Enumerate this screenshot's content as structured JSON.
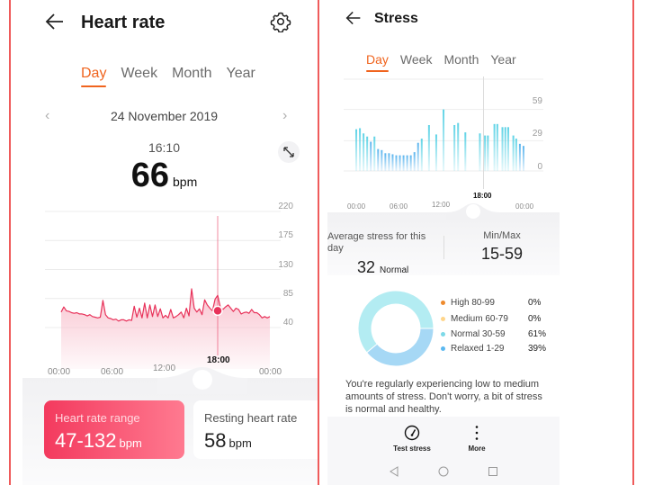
{
  "heart_rate": {
    "title": "Heart rate",
    "tabs": [
      {
        "label": "Day",
        "active": true
      },
      {
        "label": "Week",
        "active": false
      },
      {
        "label": "Month",
        "active": false
      },
      {
        "label": "Year",
        "active": false
      }
    ],
    "date": "24 November 2019",
    "selected_time": "16:10",
    "selected_value": "66",
    "unit": "bpm",
    "icons": [
      "back-arrow-icon",
      "settings-gear-icon",
      "chevron-left-icon",
      "chevron-right-icon",
      "expand-icon"
    ],
    "accent_color": "#f33a5e",
    "cards": {
      "range_label": "Heart rate range",
      "range_value": "47-132",
      "resting_label": "Resting heart rate",
      "resting_value": "58",
      "unit": "bpm"
    },
    "chart_data": {
      "type": "area",
      "title": "",
      "xlabel": "",
      "ylabel": "bpm",
      "ylim": [
        40,
        220
      ],
      "y_ticks": [
        "220",
        "175",
        "130",
        "85",
        "40"
      ],
      "x_ticks": [
        "00:00",
        "06:00",
        "12:00",
        "00:00"
      ],
      "selected_x_label": "18:00",
      "x_hours": [
        0,
        0.3,
        0.6,
        0.9,
        1.2,
        1.5,
        1.8,
        2.1,
        2.4,
        2.7,
        3.0,
        3.3,
        3.6,
        3.9,
        4.2,
        4.5,
        4.8,
        5.1,
        5.4,
        5.7,
        6.0,
        6.3,
        6.6,
        6.9,
        7.2,
        7.5,
        7.8,
        8.1,
        8.4,
        8.7,
        9.0,
        9.3,
        9.6,
        9.9,
        10.2,
        10.5,
        10.8,
        11.1,
        11.4,
        11.7,
        12.0,
        12.3,
        12.6,
        12.9,
        13.2,
        13.5,
        13.8,
        14.1,
        14.4,
        14.7,
        15.0,
        15.3,
        15.6,
        15.9,
        16.2,
        16.5,
        16.8,
        17.1,
        17.4,
        17.7,
        18.0,
        18.3,
        18.6,
        18.9,
        19.2,
        19.5,
        19.8,
        20.1,
        20.4,
        20.7,
        21.0,
        21.3,
        21.6,
        21.9,
        22.2,
        22.5,
        22.8,
        23.1,
        23.4,
        23.7,
        24.0
      ],
      "values": [
        64,
        72,
        66,
        65,
        63,
        62,
        63,
        61,
        61,
        60,
        58,
        60,
        57,
        56,
        55,
        56,
        82,
        60,
        55,
        54,
        52,
        53,
        50,
        52,
        52,
        50,
        52,
        51,
        73,
        56,
        70,
        55,
        78,
        55,
        75,
        57,
        75,
        57,
        69,
        55,
        59,
        55,
        68,
        55,
        57,
        60,
        64,
        55,
        70,
        58,
        100,
        70,
        64,
        69,
        60,
        83,
        75,
        70,
        66,
        84,
        90,
        72,
        68,
        72,
        75,
        70,
        65,
        70,
        68,
        61,
        63,
        64,
        62,
        68,
        63,
        63,
        60,
        55,
        57,
        55,
        57
      ],
      "selected_point_value": 66,
      "fill_color": "#f9c3cf",
      "line_color": "#e8325a"
    }
  },
  "stress": {
    "title": "Stress",
    "tabs": [
      {
        "label": "Day",
        "active": true
      },
      {
        "label": "Week",
        "active": false
      },
      {
        "label": "Month",
        "active": false
      },
      {
        "label": "Year",
        "active": false
      }
    ],
    "average_label": "Average stress for this day",
    "average_value": "32",
    "average_level": "Normal",
    "minmax_label": "Min/Max",
    "minmax_value": "15-59",
    "advice": "You're regularly experiencing low to medium amounts of stress. Don't worry, a bit of stress is normal and healthy.",
    "actions": [
      {
        "label": "Test stress",
        "icon": "gauge-icon"
      },
      {
        "label": "More",
        "icon": "more-vertical-icon"
      }
    ],
    "nav": [
      "back-triangle-icon",
      "home-circle-icon",
      "recents-square-icon"
    ],
    "chart_data": [
      {
        "type": "bar",
        "title": "",
        "ylim": [
          0,
          88
        ],
        "y_ticks": [
          "59",
          "29",
          "0"
        ],
        "x_ticks": [
          "00:00",
          "06:00",
          "12:00",
          "00:00"
        ],
        "selected_x_label": "18:00",
        "x_hours": [
          0.5,
          1.0,
          1.5,
          2.0,
          2.5,
          3.0,
          3.5,
          4.0,
          4.5,
          5.0,
          5.5,
          6.0,
          6.5,
          7.0,
          7.5,
          8.0,
          8.5,
          9.0,
          9.5,
          10.5,
          11.5,
          12.5,
          14.0,
          14.5,
          15.5,
          17.5,
          18.2,
          18.6,
          19.5,
          19.9,
          20.6,
          21.0,
          21.4,
          22.1,
          22.5,
          23.0,
          23.5
        ],
        "values": [
          40,
          41,
          36,
          33,
          28,
          33,
          21,
          20,
          17,
          17,
          16,
          15,
          15,
          15,
          15,
          15,
          18,
          27,
          31,
          44,
          35,
          59,
          44,
          46,
          37,
          36,
          34,
          34,
          45,
          45,
          42,
          42,
          42,
          34,
          31,
          26,
          24
        ],
        "bar_color": "#5fd3e6",
        "bar_color_low": "#5cb5ee"
      },
      {
        "type": "pie",
        "categories": [
          "High 80-99",
          "Medium 60-79",
          "Normal 30-59",
          "Relaxed 1-29"
        ],
        "values": [
          0,
          0,
          61,
          39
        ],
        "labels": [
          "0%",
          "0%",
          "61%",
          "39%"
        ],
        "colors": [
          "#ee8a2d",
          "#ffd58a",
          "#7dd9e8",
          "#5bb8f0"
        ],
        "slice_colors": [
          "#ee8a2d",
          "#ffd58a",
          "#b3ecf2",
          "#a6d8f5"
        ]
      }
    ]
  }
}
